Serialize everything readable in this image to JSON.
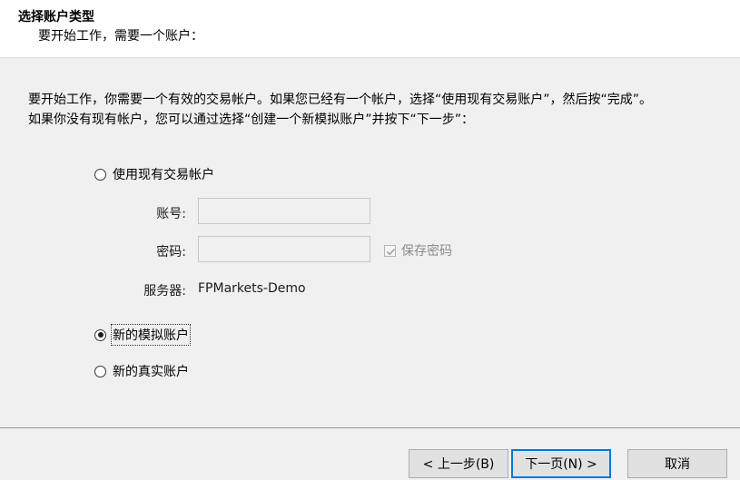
{
  "header": {
    "title": "选择账户类型",
    "subtitle": "要开始工作，需要一个账户："
  },
  "description": {
    "line1": "要开始工作，你需要一个有效的交易帐户。如果您已经有一个帐户，选择“使用现有交易账户”，然后按“完成”。",
    "line2": "如果你没有现有帐户，您可以通过选择“创建一个新模拟账户”并按下“下一步”："
  },
  "options": {
    "existing": {
      "label": "使用现有交易帐户",
      "checked": false
    },
    "demo": {
      "label": "新的模拟账户",
      "checked": true
    },
    "real": {
      "label": "新的真实账户",
      "checked": false
    }
  },
  "fields": {
    "account_label": "账号:",
    "account_value": "",
    "password_label": "密码:",
    "password_value": "",
    "save_password_label": "保存密码",
    "save_password_checked": true,
    "server_label": "服务器:",
    "server_value": "FPMarkets-Demo"
  },
  "buttons": {
    "back": "< 上一步(B)",
    "next": "下一页(N) >",
    "cancel": "取消"
  }
}
